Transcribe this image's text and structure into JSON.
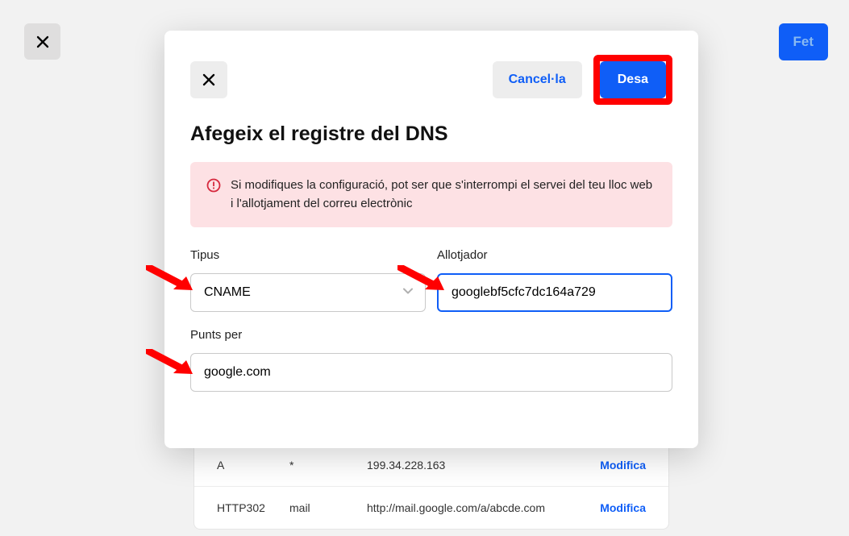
{
  "page": {
    "close_icon": "close-icon",
    "done_label": "Fet"
  },
  "bg_table": {
    "rows": [
      {
        "type": "A",
        "host": "*",
        "value": "199.34.228.163",
        "action": "Modifica"
      },
      {
        "type": "HTTP302",
        "host": "mail",
        "value": "http://mail.google.com/a/abcde.com",
        "action": "Modifica"
      }
    ]
  },
  "modal": {
    "close_icon": "close-icon",
    "cancel_label": "Cancel·la",
    "save_label": "Desa",
    "title": "Afegeix el registre del DNS",
    "warning_text": "Si modifiques la configuració, pot ser que s'interrompi el servei del teu lloc web i l'allotjament del correu electrònic",
    "type_label": "Tipus",
    "type_value": "CNAME",
    "host_label": "Allotjador",
    "host_value": "googlebf5cfc7dc164a729",
    "points_label": "Punts per",
    "points_value": "google.com"
  },
  "colors": {
    "accent": "#0f5ef7",
    "highlight": "#ff0000",
    "warning_bg": "#fde1e4"
  }
}
